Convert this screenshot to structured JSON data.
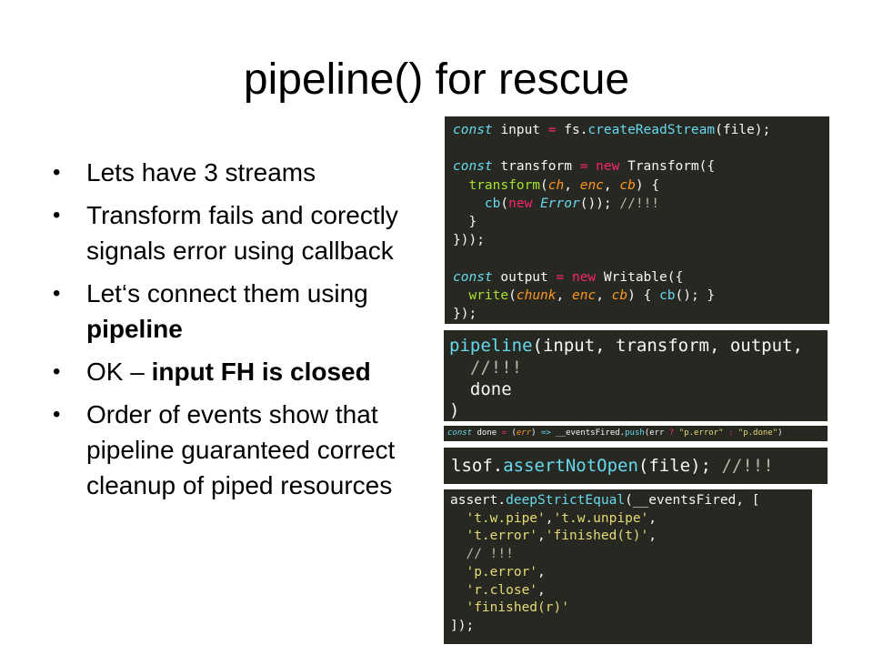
{
  "slide": {
    "title": "pipeline() for rescue",
    "bullet_marker": "•",
    "bullets": [
      {
        "text": "Lets have 3 streams"
      },
      {
        "text": "Transform fails and corectly signals error using callback"
      },
      {
        "text_before": "Let‘s connect them using ",
        "bold": "pipeline"
      },
      {
        "text_before": "OK – ",
        "bold": "input FH is closed"
      },
      {
        "text": "Order of events show that pipeline guaranteed correct cleanup of piped resources"
      }
    ]
  },
  "code_blocks": {
    "streams": {
      "l1": {
        "kw": "const",
        "a": " input ",
        "op": "=",
        "b": " fs.",
        "fn": "createReadStream",
        "c": "(file);"
      },
      "l2": {
        "kw": "const",
        "a": " transform ",
        "op": "=",
        "sp": " ",
        "nw": "new",
        "b": " Transform({"
      },
      "l3": {
        "ind": "  ",
        "gr": "transform",
        "a": "(",
        "p1": "ch",
        "s1": ", ",
        "p2": "enc",
        "s2": ", ",
        "p3": "cb",
        "b": ") {"
      },
      "l4": {
        "ind": "    ",
        "fn": "cb",
        "a": "(",
        "nw": "new",
        "sp": " ",
        "er": "Error",
        "b": "()); ",
        "cm": "//!!!"
      },
      "l5": "  }",
      "l6": "}));",
      "l7": {
        "kw": "const",
        "a": " output ",
        "op": "=",
        "sp": " ",
        "nw": "new",
        "b": " Writable({"
      },
      "l8": {
        "ind": "  ",
        "gr": "write",
        "a": "(",
        "p1": "chunk",
        "s1": ", ",
        "p2": "enc",
        "s2": ", ",
        "p3": "cb",
        "b": ") { ",
        "fn": "cb",
        "c": "(); }"
      },
      "l9": "});"
    },
    "pipeline": {
      "l1": {
        "fn": "pipeline",
        "a": "(input, transform, output,"
      },
      "l2": "  //!!!",
      "l3": "  done",
      "l4": ")"
    },
    "done": {
      "kw": "const",
      "a": " done ",
      "op": "=",
      "b": " (",
      "p": "err",
      "c": ") ",
      "arrow": "=>",
      "d": " __eventsFired.",
      "fn": "push",
      "e": "(err ",
      "q": "?",
      "sp": " ",
      "s1": "\"p.error\"",
      "f": " ",
      "colon": ":",
      "sp2": " ",
      "s2": "\"p.done\"",
      "g": ")"
    },
    "lsof": {
      "a": "lsof.",
      "fn": "assertNotOpen",
      "b": "(file); ",
      "cm": "//!!!"
    },
    "assert": {
      "l1": {
        "a": "assert.",
        "fn": "deepStrictEqual",
        "b": "(__eventsFired, ["
      },
      "l2": {
        "ind": "  ",
        "s1": "'t.w.pipe'",
        "a": ",",
        "s2": "'t.w.unpipe'",
        "b": ","
      },
      "l3": {
        "ind": "  ",
        "s1": "'t.error'",
        "a": ",",
        "s2": "'finished(t)'",
        "b": ","
      },
      "l4": {
        "ind": "  ",
        "cm": "// !!!"
      },
      "l5": {
        "ind": "  ",
        "s1": "'p.error'",
        "a": ","
      },
      "l6": {
        "ind": "  ",
        "s1": "'r.close'",
        "a": ","
      },
      "l7": {
        "ind": "  ",
        "s1": "'finished(r)'"
      },
      "l8": "]);"
    }
  }
}
